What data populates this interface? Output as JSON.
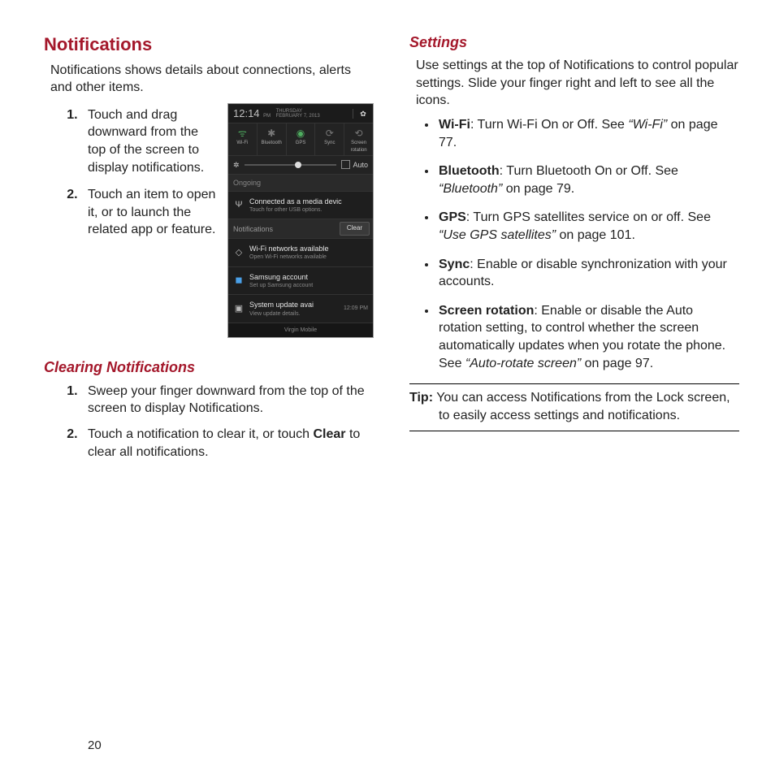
{
  "left": {
    "title": "Notifications",
    "intro": "Notifications shows details about connections, alerts and other items.",
    "step1": "Touch and drag downward from the top of the screen to display notifications.",
    "step2": "Touch an item to open it, or to launch the related app or feature.",
    "clearing_title": "Clearing Notifications",
    "clear_step1": "Sweep your finger downward from the top of the screen to display Notifications.",
    "clear_step2_pre": "Touch a notification to clear it, or touch ",
    "clear_step2_bold": "Clear",
    "clear_step2_post": " to clear all notifications."
  },
  "right": {
    "settings_title": "Settings",
    "settings_intro": "Use settings at the top of Notifications to control popular settings. Slide your finger right and left to see all the icons.",
    "b_wifi_label": "Wi-Fi",
    "b_wifi_text": ": Turn Wi-Fi On or Off. See ",
    "b_wifi_ref": "“Wi-Fi”",
    "b_wifi_post": " on page 77.",
    "b_bt_label": "Bluetooth",
    "b_bt_text": ": Turn Bluetooth On or Off. See ",
    "b_bt_ref": "“Bluetooth”",
    "b_bt_post": " on page 79.",
    "b_gps_label": "GPS",
    "b_gps_text": ": Turn GPS satellites service on or off. See ",
    "b_gps_ref": "“Use GPS satellites”",
    "b_gps_post": " on page 101.",
    "b_sync_label": "Sync",
    "b_sync_text": ": Enable or disable synchronization with your accounts.",
    "b_rot_label": "Screen rotation",
    "b_rot_text": ": Enable or disable the Auto rotation setting, to control whether the screen automatically updates when you rotate the phone. See ",
    "b_rot_ref": "“Auto-rotate screen”",
    "b_rot_post": " on page 97.",
    "tip_label": "Tip:",
    "tip_text": " You can access Notifications from the Lock screen, to easily access settings and notifications."
  },
  "phone": {
    "time": "12:14",
    "ampm": "PM",
    "day": "THURSDAY",
    "date": "FEBRUARY 7, 2013",
    "tg_wifi": "Wi-Fi",
    "tg_bt": "Bluetooth",
    "tg_gps": "GPS",
    "tg_sync": "Sync",
    "tg_rot": "Screen rotation",
    "auto": "Auto",
    "ongoing": "Ongoing",
    "media_title": "Connected as a media devic",
    "media_sub": "Touch for other USB options.",
    "notif_label": "Notifications",
    "clear": "Clear",
    "wifi_net_title": "Wi-Fi networks available",
    "wifi_net_sub": "Open Wi-Fi networks available",
    "sams_title": "Samsung account",
    "sams_sub": "Set up Samsung account",
    "sys_title": "System update avai",
    "sys_sub": "View update details.",
    "sys_time": "12:09 PM",
    "carrier": "Virgin Mobile"
  },
  "page_number": "20"
}
